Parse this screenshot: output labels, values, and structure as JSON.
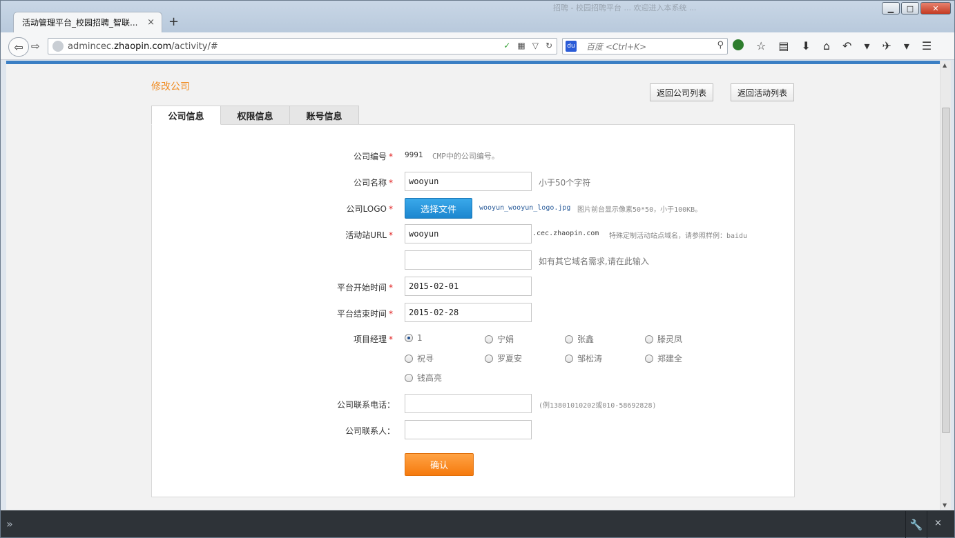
{
  "browser": {
    "tab_title": "活动管理平台_校园招聘_智联...",
    "tab_close": "×",
    "new_tab": "+",
    "url_prefix": "admincec.",
    "url_domain": "zhaopin.com",
    "url_path": "/activity/#",
    "search_placeholder": "百度 <Ctrl+K>",
    "blurred_title": "招聘 - 校园招聘平台 ... 欢迎进入本系统 ...",
    "win_minimize": "▁",
    "win_maximize": "□",
    "win_close": "✕",
    "back_glyph": "⇦",
    "forward_glyph": "⇨",
    "search_glyph": "⚲",
    "engine_glyph": "du",
    "url_icon_glyphs": [
      "✓",
      "▦",
      "▽",
      "↻"
    ],
    "tool_icon_glyphs": [
      "☆",
      "▤",
      "⬇",
      "⌂",
      "↶",
      "▾",
      "✈",
      "▾",
      "☰"
    ]
  },
  "page": {
    "title": "修改公司",
    "back_to_company_list": "返回公司列表",
    "back_to_activity_list": "返回活动列表",
    "tabs": [
      "公司信息",
      "权限信息",
      "账号信息"
    ],
    "form": {
      "company_id_label": "公司编号",
      "company_id_value": "9991",
      "company_id_hint": "CMP中的公司编号。",
      "company_name_label": "公司名称",
      "company_name_value": "wooyun",
      "company_name_hint": "小于50个字符",
      "logo_label": "公司LOGO",
      "logo_button": "选择文件",
      "logo_filename": "wooyun_wooyun_logo.jpg",
      "logo_hint": "图片前台显示像素50*50，小于100KB。",
      "site_url_label": "活动站URL",
      "site_url_value": "wooyun",
      "site_url_suffix": ".cec.zhaopin.com",
      "site_url_hint": "特殊定制活动站点域名，请参照样例：baidu",
      "other_domain_value": "",
      "other_domain_hint": "如有其它域名需求,请在此输入",
      "start_label": "平台开始时间",
      "start_value": "2015-02-01",
      "end_label": "平台结束时间",
      "end_value": "2015-02-28",
      "manager_label": "项目经理",
      "managers": [
        "1",
        "宁娟",
        "张鑫",
        "滕灵凤",
        "祝寻",
        "罗夏安",
        "邹松涛",
        "郑建全",
        "钱高亮"
      ],
      "selected_manager": "1",
      "phone_label": "公司联系电话：",
      "phone_value": "",
      "phone_hint": "(例13801010202或010-58692828)",
      "contact_label": "公司联系人：",
      "contact_value": "",
      "confirm_button": "确认",
      "required_mark": "*"
    }
  },
  "devtools": {
    "expand_glyph": "»",
    "settings_glyph": "🔧",
    "close_glyph": "×"
  },
  "colors": {
    "accent_orange": "#f08a1e",
    "button_blue": "#1c86cf",
    "confirm_orange": "#f57a0d",
    "required_red": "#e02020"
  }
}
